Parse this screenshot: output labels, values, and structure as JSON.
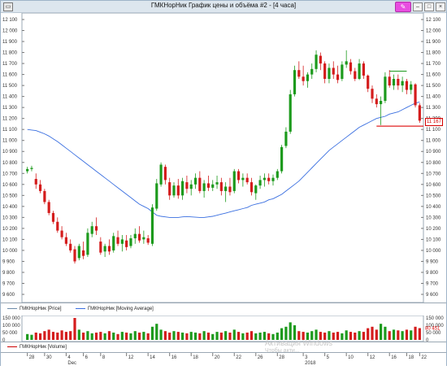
{
  "window": {
    "title": "ГМКНорНик График цены и объёма #2 - [4 часа]",
    "pin_icon": "pin-icon",
    "minimize_icon": "minimize-icon",
    "maximize_icon": "maximize-icon",
    "close_icon": "close-icon"
  },
  "legend": {
    "price_label": "ГМКНорНик [Price]",
    "ma_label": "ГМКНорНик [Moving Average]",
    "volume_label": "ГМКНорНик [Volume]",
    "ma_color": "#3a6fe0",
    "price_line_color": "#6d8ba8",
    "volume_line_color": "#cc0000"
  },
  "price_axis": {
    "ticks": [
      "12 100",
      "12 000",
      "11 900",
      "11 800",
      "11 700",
      "11 600",
      "11 500",
      "11 400",
      "11 300",
      "11 200",
      "11 100",
      "11 000",
      "10 900",
      "10 800",
      "10 700",
      "10 600",
      "10 500",
      "10 400",
      "10 300",
      "10 200",
      "10 100",
      "10 000",
      "9 900",
      "9 800",
      "9 700",
      "9 600"
    ],
    "current_price": "11 167",
    "current_price_color": "#d40000"
  },
  "volume_axis": {
    "ticks": [
      "150 000",
      "100 000",
      "50 000",
      "0"
    ],
    "current_volume": "80 451"
  },
  "date_axis": {
    "days": [
      "28",
      "30",
      "4",
      "6",
      "8",
      "12",
      "14",
      "16",
      "18",
      "20",
      "22",
      "26",
      "28",
      "3",
      "5",
      "10",
      "12",
      "16",
      "18",
      "22"
    ],
    "months": [
      "Dec",
      "2018"
    ]
  },
  "watermark": {
    "line1": "Активация Windows",
    "line2": "Чтобы акти..."
  },
  "colors": {
    "up": "#1c9a1c",
    "down": "#d41c1c",
    "support_line": "#e02020",
    "resistance_line": "#1c9a1c"
  },
  "chart_data": {
    "type": "candlestick",
    "timeframe": "4 часа",
    "ylim": [
      9600,
      12100
    ],
    "levels": {
      "support": 11130,
      "resistance": 11630
    },
    "candles": [
      [
        10720,
        10760,
        10700,
        10740
      ],
      [
        10740,
        10770,
        10720,
        10750
      ],
      [
        10650,
        10700,
        10560,
        10600
      ],
      [
        10600,
        10640,
        10520,
        10540
      ],
      [
        10540,
        10560,
        10420,
        10440
      ],
      [
        10440,
        10460,
        10320,
        10340
      ],
      [
        10340,
        10360,
        10240,
        10260
      ],
      [
        10260,
        10300,
        10160,
        10180
      ],
      [
        10180,
        10220,
        10100,
        10120
      ],
      [
        10120,
        10160,
        10040,
        10060
      ],
      [
        10060,
        10100,
        9980,
        10000
      ],
      [
        10010,
        10040,
        9880,
        9900
      ],
      [
        9930,
        10060,
        9910,
        10040
      ],
      [
        10000,
        10080,
        9920,
        9950
      ],
      [
        9960,
        10200,
        9940,
        10160
      ],
      [
        10150,
        10260,
        10120,
        10220
      ],
      [
        10220,
        10300,
        10140,
        10180
      ],
      [
        10080,
        10120,
        9960,
        9980
      ],
      [
        9990,
        10060,
        9940,
        10040
      ],
      [
        10040,
        10100,
        9960,
        9990
      ],
      [
        10000,
        10160,
        9980,
        10130
      ],
      [
        10120,
        10180,
        10040,
        10060
      ],
      [
        10060,
        10140,
        9990,
        10100
      ],
      [
        10090,
        10140,
        10000,
        10030
      ],
      [
        10040,
        10140,
        10020,
        10110
      ],
      [
        10110,
        10200,
        10060,
        10150
      ],
      [
        10150,
        10220,
        10070,
        10090
      ],
      [
        10100,
        10180,
        10060,
        10120
      ],
      [
        10110,
        10140,
        10050,
        10070
      ],
      [
        10060,
        10420,
        10040,
        10390
      ],
      [
        10380,
        10650,
        10360,
        10610
      ],
      [
        10600,
        10800,
        10580,
        10780
      ],
      [
        10760,
        10780,
        10600,
        10640
      ],
      [
        10620,
        10660,
        10460,
        10500
      ],
      [
        10500,
        10620,
        10480,
        10590
      ],
      [
        10590,
        10650,
        10470,
        10500
      ],
      [
        10500,
        10660,
        10460,
        10630
      ],
      [
        10620,
        10680,
        10520,
        10560
      ],
      [
        10560,
        10640,
        10500,
        10600
      ],
      [
        10600,
        10700,
        10560,
        10660
      ],
      [
        10660,
        10720,
        10520,
        10540
      ],
      [
        10540,
        10640,
        10480,
        10610
      ],
      [
        10610,
        10680,
        10540,
        10570
      ],
      [
        10570,
        10640,
        10540,
        10600
      ],
      [
        10600,
        10680,
        10560,
        10620
      ],
      [
        10620,
        10660,
        10500,
        10540
      ],
      [
        10540,
        10620,
        10440,
        10580
      ],
      [
        10580,
        10660,
        10500,
        10530
      ],
      [
        10540,
        10740,
        10520,
        10720
      ],
      [
        10720,
        10740,
        10610,
        10640
      ],
      [
        10640,
        10700,
        10580,
        10660
      ],
      [
        10660,
        10700,
        10600,
        10620
      ],
      [
        10620,
        10660,
        10500,
        10530
      ],
      [
        10520,
        10600,
        10460,
        10590
      ],
      [
        10590,
        10680,
        10560,
        10640
      ],
      [
        10640,
        10700,
        10580,
        10660
      ],
      [
        10660,
        10700,
        10600,
        10630
      ],
      [
        10630,
        10690,
        10590,
        10660
      ],
      [
        10660,
        10740,
        10640,
        10720
      ],
      [
        10720,
        10960,
        10700,
        10940
      ],
      [
        10950,
        11120,
        10930,
        11080
      ],
      [
        11080,
        11460,
        11060,
        11420
      ],
      [
        11420,
        11680,
        11400,
        11640
      ],
      [
        11640,
        11720,
        11560,
        11580
      ],
      [
        11580,
        11680,
        11500,
        11540
      ],
      [
        11540,
        11620,
        11480,
        11600
      ],
      [
        11600,
        11700,
        11560,
        11650
      ],
      [
        11650,
        11820,
        11620,
        11780
      ],
      [
        11770,
        11800,
        11640,
        11700
      ],
      [
        11700,
        11720,
        11520,
        11560
      ],
      [
        11560,
        11700,
        11520,
        11660
      ],
      [
        11660,
        11720,
        11560,
        11600
      ],
      [
        11600,
        11680,
        11520,
        11550
      ],
      [
        11560,
        11720,
        11540,
        11690
      ],
      [
        11690,
        11820,
        11660,
        11720
      ],
      [
        11710,
        11740,
        11600,
        11630
      ],
      [
        11630,
        11660,
        11540,
        11560
      ],
      [
        11560,
        11740,
        11550,
        11700
      ],
      [
        11700,
        11720,
        11560,
        11590
      ],
      [
        11590,
        11600,
        11440,
        11470
      ],
      [
        11470,
        11500,
        11340,
        11380
      ],
      [
        11380,
        11420,
        11300,
        11330
      ],
      [
        11330,
        11400,
        11140,
        11360
      ],
      [
        11360,
        11620,
        11340,
        11580
      ],
      [
        11580,
        11640,
        11480,
        11500
      ],
      [
        11500,
        11600,
        11460,
        11560
      ],
      [
        11560,
        11600,
        11460,
        11500
      ],
      [
        11500,
        11580,
        11440,
        11540
      ],
      [
        11540,
        11560,
        11420,
        11460
      ],
      [
        11460,
        11540,
        11420,
        11510
      ],
      [
        11510,
        11520,
        11300,
        11320
      ],
      [
        11320,
        11340,
        11160,
        11180
      ]
    ],
    "moving_average": [
      11100,
      11095,
      11090,
      11075,
      11060,
      11040,
      11015,
      10990,
      10960,
      10930,
      10900,
      10870,
      10840,
      10810,
      10780,
      10750,
      10720,
      10690,
      10660,
      10630,
      10600,
      10570,
      10540,
      10510,
      10480,
      10450,
      10420,
      10400,
      10380,
      10350,
      10320,
      10310,
      10305,
      10300,
      10300,
      10300,
      10305,
      10308,
      10305,
      10302,
      10300,
      10300,
      10305,
      10310,
      10320,
      10330,
      10340,
      10350,
      10360,
      10370,
      10380,
      10390,
      10410,
      10420,
      10430,
      10440,
      10460,
      10470,
      10490,
      10510,
      10540,
      10570,
      10600,
      10630,
      10670,
      10710,
      10750,
      10790,
      10830,
      10870,
      10910,
      10940,
      10970,
      11000,
      11030,
      11060,
      11090,
      11120,
      11140,
      11160,
      11180,
      11200,
      11210,
      11220,
      11240,
      11250,
      11260,
      11280,
      11300,
      11320,
      11340,
      11350
    ],
    "volume": [
      40000,
      35000,
      50000,
      45000,
      60000,
      70000,
      55000,
      50000,
      65000,
      55000,
      60000,
      150000,
      70000,
      50000,
      60000,
      45000,
      50000,
      55000,
      45000,
      60000,
      50000,
      40000,
      55000,
      50000,
      45000,
      60000,
      50000,
      55000,
      45000,
      90000,
      110000,
      70000,
      60000,
      50000,
      60000,
      55000,
      50000,
      45000,
      55000,
      50000,
      45000,
      60000,
      50000,
      40000,
      55000,
      50000,
      60000,
      50000,
      70000,
      55000,
      45000,
      50000,
      60000,
      45000,
      50000,
      55000,
      45000,
      40000,
      50000,
      80000,
      90000,
      120000,
      100000,
      60000,
      55000,
      50000,
      60000,
      70000,
      55000,
      50000,
      60000,
      50000,
      55000,
      45000,
      65000,
      55000,
      50000,
      60000,
      55000,
      80000,
      90000,
      70000,
      110000,
      90000,
      60000,
      70000,
      65000,
      60000,
      70000,
      65000,
      90000,
      80451
    ]
  }
}
